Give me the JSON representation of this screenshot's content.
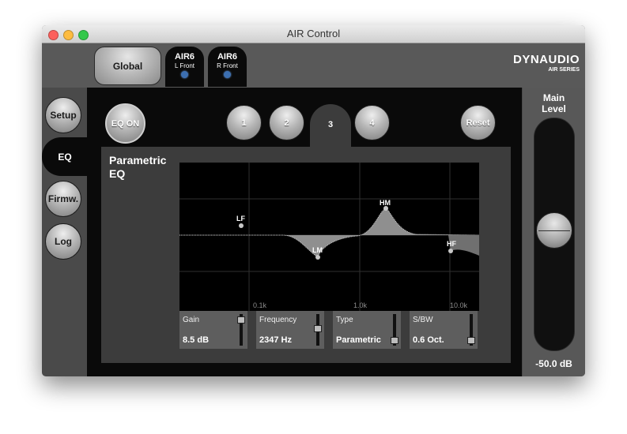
{
  "window": {
    "title": "AIR Control"
  },
  "header": {
    "global_label": "Global",
    "devices": [
      {
        "name": "AIR6",
        "position": "L Front",
        "indicator_color": "#3c6fb1"
      },
      {
        "name": "AIR6",
        "position": "R Front",
        "indicator_color": "#3c6fb1"
      }
    ],
    "brand": {
      "name": "DYNAUDIO",
      "series": "AIR SERIES"
    }
  },
  "sidebar": {
    "items": [
      {
        "label": "Setup",
        "selected": false
      },
      {
        "label": "EQ",
        "selected": true
      },
      {
        "label": "Firmw.",
        "selected": false
      },
      {
        "label": "Log",
        "selected": false
      }
    ]
  },
  "eq": {
    "eq_on_label": "EQ ON",
    "bands": [
      {
        "label": "1",
        "selected": false
      },
      {
        "label": "2",
        "selected": false
      },
      {
        "label": "3",
        "selected": true
      },
      {
        "label": "4",
        "selected": false
      }
    ],
    "reset_label": "Reset",
    "title_line1": "Parametric",
    "title_line2": "EQ",
    "graph": {
      "x_tick_labels": [
        "0.1k",
        "1.0k",
        "10.0k"
      ],
      "points": [
        {
          "label": "LF"
        },
        {
          "label": "LM"
        },
        {
          "label": "HM"
        },
        {
          "label": "HF"
        }
      ]
    },
    "params": {
      "gain": {
        "label": "Gain",
        "value": "8.5 dB",
        "level": 0.9
      },
      "frequency": {
        "label": "Frequency",
        "value": "2347 Hz",
        "level": 0.55
      },
      "type": {
        "label": "Type",
        "value": "Parametric",
        "level": 0.05
      },
      "sbw": {
        "label": "S/BW",
        "value": "0.6 Oct.",
        "level": 0.05
      }
    }
  },
  "main_level": {
    "label_line1": "Main",
    "label_line2": "Level",
    "value": "-50.0 dB",
    "level": 0.52
  }
}
